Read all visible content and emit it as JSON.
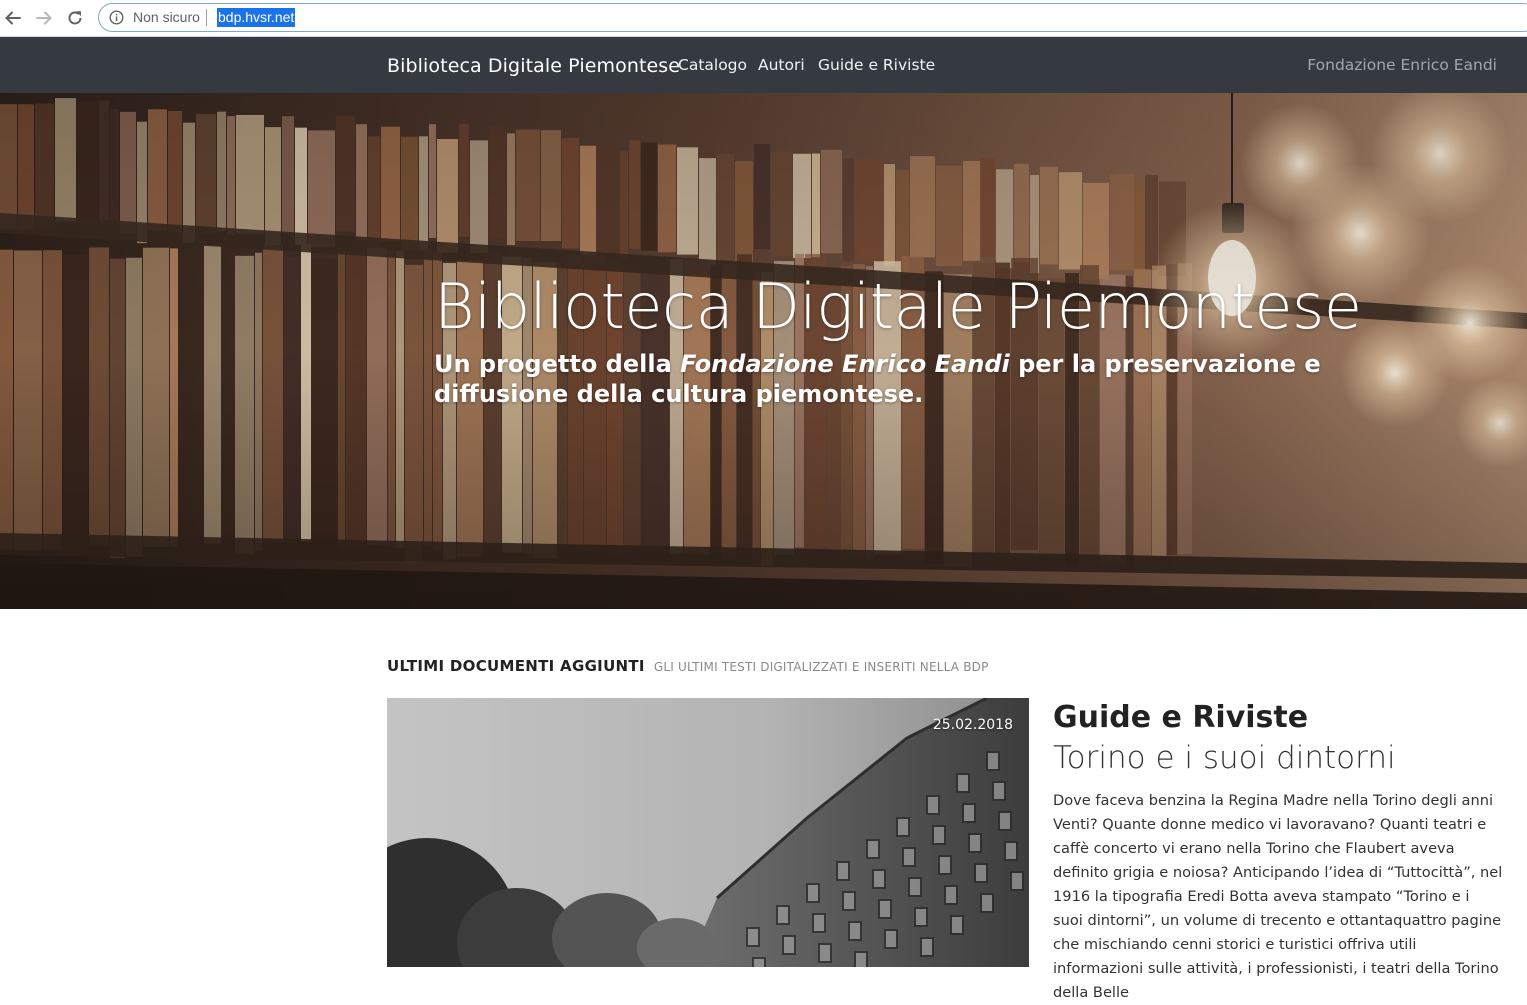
{
  "browser": {
    "security_label": "Non sicuro",
    "url": "bdp.hvsr.net"
  },
  "navbar": {
    "brand": "Biblioteca Digitale Piemontese",
    "links": [
      "Catalogo",
      "Autori",
      "Guide e Riviste"
    ],
    "right_link": "Fondazione Enrico Eandi"
  },
  "hero": {
    "title": "Biblioteca Digitale Piemontese",
    "subtitle_before": "Un progetto della ",
    "subtitle_emphasis": "Fondazione Enrico Eandi",
    "subtitle_after": " per la preservazione e diffusione della cultura piemontese."
  },
  "latest": {
    "title": "ULTIMI DOCUMENTI AGGIUNTI",
    "subtitle": "GLI ULTIMI TESTI DIGITALIZZATI E INSERITI NELLA BDP"
  },
  "featured": {
    "date": "25.02.2018",
    "category": "Guide e Riviste",
    "title": "Torino e i suoi dintorni",
    "description": "Dove faceva benzina la Regina Madre nella Torino degli anni Venti? Quante donne medico vi lavoravano? Quanti teatri e caffè concerto vi erano nella Torino che Flaubert aveva definito grigia e noiosa? Anticipando l’idea di “Tuttocittà”, nel 1916 la tipografia Eredi Botta aveva stampato “Torino e i suoi dintorni”, un volume di trecento e ottantaquattro pagine che mischiando cenni storici e turistici offriva utili informazioni sulle attività, i professionisti, i teatri della Torino della Belle"
  },
  "colors": {
    "navbar_bg": "#343a40",
    "url_highlight": "#1a73e8"
  },
  "icons": [
    "back-arrow-icon",
    "forward-arrow-icon",
    "reload-icon",
    "info-icon"
  ]
}
